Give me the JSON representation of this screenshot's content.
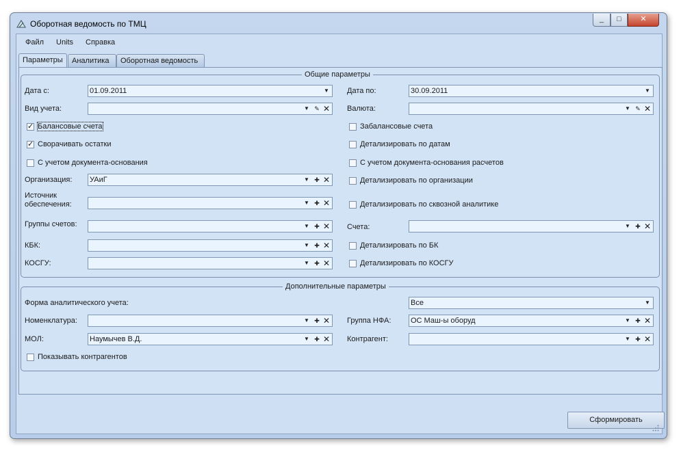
{
  "window": {
    "title": "Оборотная ведомость по ТМЦ",
    "controls": {
      "minimize": "_",
      "maximize": "□",
      "close": "✕"
    }
  },
  "menu": [
    "Файл",
    "Units",
    "Справка"
  ],
  "tabs": [
    "Параметры",
    "Аналитика",
    "Оборотная ведомость"
  ],
  "general": {
    "title": "Общие параметры",
    "date_from_label": "Дата с:",
    "date_from": "01.09.2011",
    "date_to_label": "Дата по:",
    "date_to": "30.09.2011",
    "account_type_label": "Вид учета:",
    "account_type": "",
    "currency_label": "Валюта:",
    "currency": "",
    "balance_accounts": "Балансовые счета",
    "offbalance_accounts": "Забалансовые счета",
    "collapse_balances": "Сворачивать остатки",
    "detail_by_dates": "Детализировать по датам",
    "with_base_doc": "С учетом документа-основания",
    "with_base_doc_settlements": "С учетом документа-основания расчетов",
    "organization_label": "Организация:",
    "organization": "УАиГ",
    "detail_by_org": "Детализировать по организации",
    "funding_source_label_1": "Источник",
    "funding_source_label_2": "обеспечения:",
    "funding_source": "",
    "detail_by_analytics": "Детализировать по сквозной аналитике",
    "account_groups_label": "Группы счетов:",
    "account_groups": "",
    "accounts_label": "Счета:",
    "accounts": "",
    "kbk_label": "КБК:",
    "kbk": "",
    "detail_by_bk": "Детализировать по БК",
    "kosgu_label": "КОСГУ:",
    "kosgu": "",
    "detail_by_kosgu": "Детализировать по КОСГУ"
  },
  "extra": {
    "title": "Дополнительные параметры",
    "analytic_form_label": "Форма аналитического учета:",
    "analytic_form": "Все",
    "nomenclature_label": "Номенклатура:",
    "nomenclature": "",
    "nfa_group_label": "Группа НФА:",
    "nfa_group": "ОС Маш-ы оборуд",
    "mol_label": "МОЛ:",
    "mol": "Наумычев В.Д.",
    "counterparty_label": "Контрагент:",
    "counterparty": "",
    "show_counterparties": "Показывать контрагентов"
  },
  "actions": {
    "generate": "Сформировать"
  },
  "glyphs": {
    "dropdown": "▼",
    "add": "✚",
    "clear": "✕",
    "edit": "✎",
    "check": "✓"
  }
}
